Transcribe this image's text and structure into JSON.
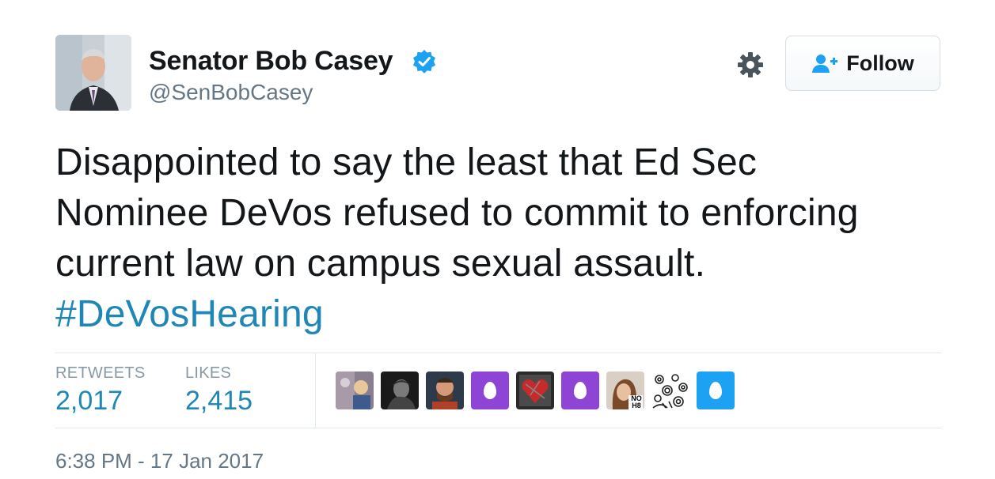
{
  "user": {
    "display_name": "Senator Bob Casey",
    "handle": "@SenBobCasey",
    "verified": true,
    "verified_color": "#1da1f2"
  },
  "actions": {
    "follow_label": "Follow"
  },
  "tweet": {
    "lines": [
      "Disappointed to say the least that Ed Sec",
      "Nominee DeVos refused to commit to enforcing",
      "current law on campus sexual assault."
    ],
    "hashtag": "#DeVosHearing"
  },
  "stats": {
    "retweets_label": "RETWEETS",
    "retweets_value": "2,017",
    "likes_label": "LIKES",
    "likes_value": "2,415"
  },
  "liker_avatars": [
    "photo",
    "photo",
    "photo",
    "egg",
    "photo",
    "egg",
    "photo",
    "photo",
    "egg"
  ],
  "liker_egg_colors": [
    "#8e44d4",
    "#8e44d4",
    "#1da1f2"
  ],
  "liker_badge_text": "NO H8",
  "timestamp": "6:38 PM - 17 Jan 2017",
  "colors": {
    "link": "#1e87b5",
    "muted": "#657786",
    "text": "#14171a"
  }
}
